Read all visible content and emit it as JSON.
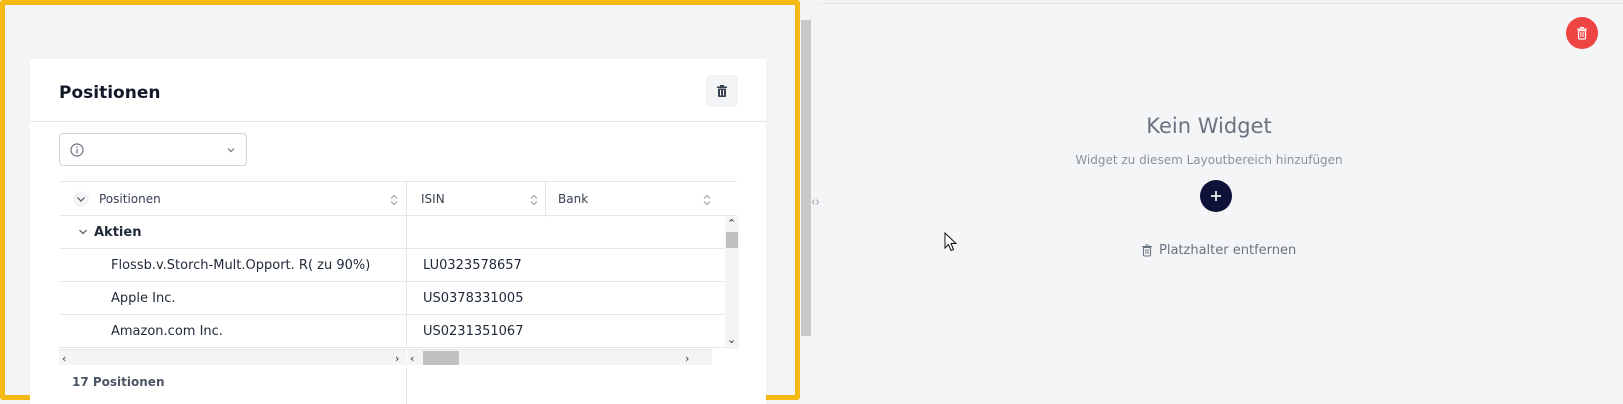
{
  "left_panel": {
    "card": {
      "title": "Positionen",
      "delete_icon": "trash-icon",
      "filter": {
        "value": "",
        "icon": "info-icon"
      },
      "grid": {
        "columns": [
          {
            "label": "Positionen"
          },
          {
            "label": "ISIN"
          },
          {
            "label": "Bank"
          }
        ],
        "group": {
          "label": "Aktien"
        },
        "rows": [
          {
            "name": "Flossb.v.Storch-Mult.Opport. R( zu 90%)",
            "isin": "LU0323578657"
          },
          {
            "name": "Apple Inc.",
            "isin": "US0378331005"
          },
          {
            "name": "Amazon.com Inc.",
            "isin": "US0231351067"
          }
        ],
        "footer_count": "17 Positionen"
      }
    }
  },
  "right_panel": {
    "title": "Kein Widget",
    "subtitle": "Widget zu diesem Layoutbereich hinzufügen",
    "add_icon": "plus-icon",
    "remove_label": "Platzhalter entfernen",
    "delete_color": "#ef4444"
  },
  "colors": {
    "highlight_border": "#f5b914",
    "accent_dark": "#0f1238"
  }
}
